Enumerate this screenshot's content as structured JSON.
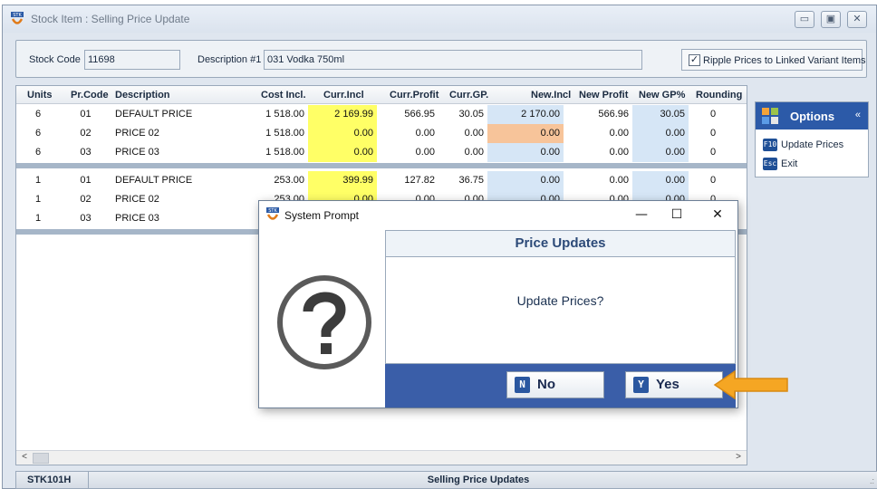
{
  "window": {
    "title": "Stock Item : Selling Price Update",
    "minimize": "▭",
    "maximize": "▣",
    "close": "✕"
  },
  "header": {
    "stock_code_label": "Stock Code",
    "stock_code_value": "11698",
    "description_label": "Description #1",
    "description_value": "031 Vodka 750ml",
    "ripple_label": "Ripple Prices to Linked Variant Items",
    "ripple_checked": "✓"
  },
  "grid": {
    "columns": [
      "Units",
      "Pr.Code",
      "Description",
      "Cost Incl.",
      "Curr.Incl",
      "Curr.Profit",
      "Curr.GP.",
      "New.Incl",
      "New Profit",
      "New GP%",
      "Rounding"
    ],
    "groups": [
      [
        [
          "6",
          "01",
          "DEFAULT PRICE",
          "1 518.00",
          "2 169.99",
          "566.95",
          "30.05",
          "2 170.00",
          "566.96",
          "30.05",
          "0"
        ],
        [
          "6",
          "02",
          "PRICE 02",
          "1 518.00",
          "0.00",
          "0.00",
          "0.00",
          "0.00",
          "0.00",
          "0.00",
          "0"
        ],
        [
          "6",
          "03",
          "PRICE 03",
          "1 518.00",
          "0.00",
          "0.00",
          "0.00",
          "0.00",
          "0.00",
          "0.00",
          "0"
        ]
      ],
      [
        [
          "1",
          "01",
          "DEFAULT PRICE",
          "253.00",
          "399.99",
          "127.82",
          "36.75",
          "0.00",
          "0.00",
          "0.00",
          "0"
        ],
        [
          "1",
          "02",
          "PRICE 02",
          "253.00",
          "0.00",
          "0.00",
          "0.00",
          "0.00",
          "0.00",
          "0.00",
          "0"
        ],
        [
          "1",
          "03",
          "PRICE 03",
          "",
          "",
          "",
          "",
          "",
          "",
          "",
          ""
        ]
      ]
    ]
  },
  "scroll": {
    "left": "<",
    "right": ">"
  },
  "options": {
    "title": "Options",
    "collapse": "«",
    "items": [
      {
        "key": "F10",
        "label": "Update Prices"
      },
      {
        "key": "Esc",
        "label": "Exit"
      }
    ]
  },
  "status": {
    "code": "STK101H",
    "title": "Selling Price Updates",
    "grip": ".:"
  },
  "dialog": {
    "title": "System Prompt",
    "minimize": "—",
    "maximize": "☐",
    "close": "✕",
    "heading": "Price Updates",
    "message": "Update Prices?",
    "no_key": "N",
    "no_label": "No",
    "yes_key": "Y",
    "yes_label": "Yes"
  },
  "colors": {
    "accent_blue": "#2c5aa8",
    "highlight_yellow": "#ffff66",
    "highlight_orange": "#f7c49a",
    "pointer_orange": "#f5a623"
  }
}
